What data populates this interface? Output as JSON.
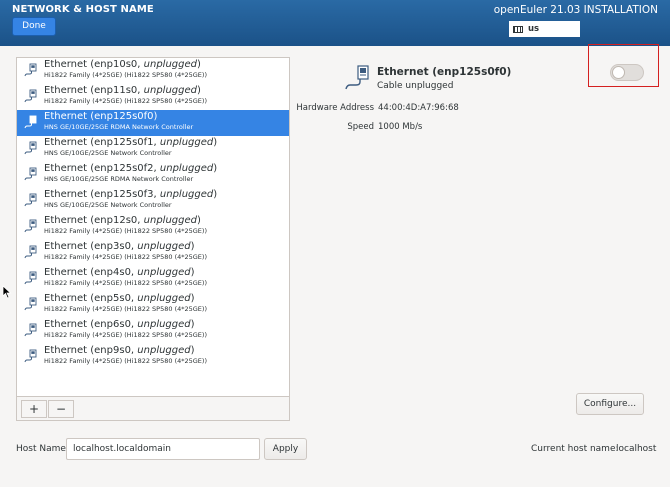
{
  "header": {
    "title": "NETWORK & HOST NAME",
    "done_label": "Done",
    "install_title": "openEuler 21.03 INSTALLATION",
    "keyboard_layout": "us"
  },
  "devices": [
    {
      "name": "Ethernet (enp10s0, ",
      "state": "unplugged",
      "suffix": ")",
      "model": "Hi1822 Family (4*25GE) (Hi1822 SP580 (4*25GE))",
      "selected": false
    },
    {
      "name": "Ethernet (enp11s0, ",
      "state": "unplugged",
      "suffix": ")",
      "model": "Hi1822 Family (4*25GE) (Hi1822 SP580 (4*25GE))",
      "selected": false
    },
    {
      "name": "Ethernet (enp125s0f0)",
      "state": "",
      "suffix": "",
      "model": "HNS GE/10GE/25GE RDMA Network Controller",
      "selected": true
    },
    {
      "name": "Ethernet (enp125s0f1, ",
      "state": "unplugged",
      "suffix": ")",
      "model": "HNS GE/10GE/25GE Network Controller",
      "selected": false
    },
    {
      "name": "Ethernet (enp125s0f2, ",
      "state": "unplugged",
      "suffix": ")",
      "model": "HNS GE/10GE/25GE RDMA Network Controller",
      "selected": false
    },
    {
      "name": "Ethernet (enp125s0f3, ",
      "state": "unplugged",
      "suffix": ")",
      "model": "HNS GE/10GE/25GE Network Controller",
      "selected": false
    },
    {
      "name": "Ethernet (enp12s0, ",
      "state": "unplugged",
      "suffix": ")",
      "model": "Hi1822 Family (4*25GE) (Hi1822 SP580 (4*25GE))",
      "selected": false
    },
    {
      "name": "Ethernet (enp3s0, ",
      "state": "unplugged",
      "suffix": ")",
      "model": "Hi1822 Family (4*25GE) (Hi1822 SP580 (4*25GE))",
      "selected": false
    },
    {
      "name": "Ethernet (enp4s0, ",
      "state": "unplugged",
      "suffix": ")",
      "model": "Hi1822 Family (4*25GE) (Hi1822 SP580 (4*25GE))",
      "selected": false
    },
    {
      "name": "Ethernet (enp5s0, ",
      "state": "unplugged",
      "suffix": ")",
      "model": "Hi1822 Family (4*25GE) (Hi1822 SP580 (4*25GE))",
      "selected": false
    },
    {
      "name": "Ethernet (enp6s0, ",
      "state": "unplugged",
      "suffix": ")",
      "model": "Hi1822 Family (4*25GE) (Hi1822 SP580 (4*25GE))",
      "selected": false
    },
    {
      "name": "Ethernet (enp9s0, ",
      "state": "unplugged",
      "suffix": ")",
      "model": "Hi1822 Family (4*25GE) (Hi1822 SP580 (4*25GE))",
      "selected": false
    }
  ],
  "list_toolbar": {
    "add_label": "+",
    "remove_label": "−"
  },
  "detail": {
    "name": "Ethernet (enp125s0f0)",
    "status": "Cable unplugged",
    "toggle_on": false,
    "hw_label": "Hardware Address",
    "hw_value": "44:00:4D:A7:96:68",
    "speed_label": "Speed",
    "speed_value": "1000 Mb/s",
    "configure_label": "Configure..."
  },
  "hostname": {
    "label": "Host Name:",
    "value": "localhost.localdomain",
    "apply_label": "Apply",
    "current_label": "Current host name:",
    "current_value": "localhost"
  },
  "colors": {
    "header": "#1e5a92",
    "selection": "#3584e4",
    "highlight": "#d42020"
  }
}
